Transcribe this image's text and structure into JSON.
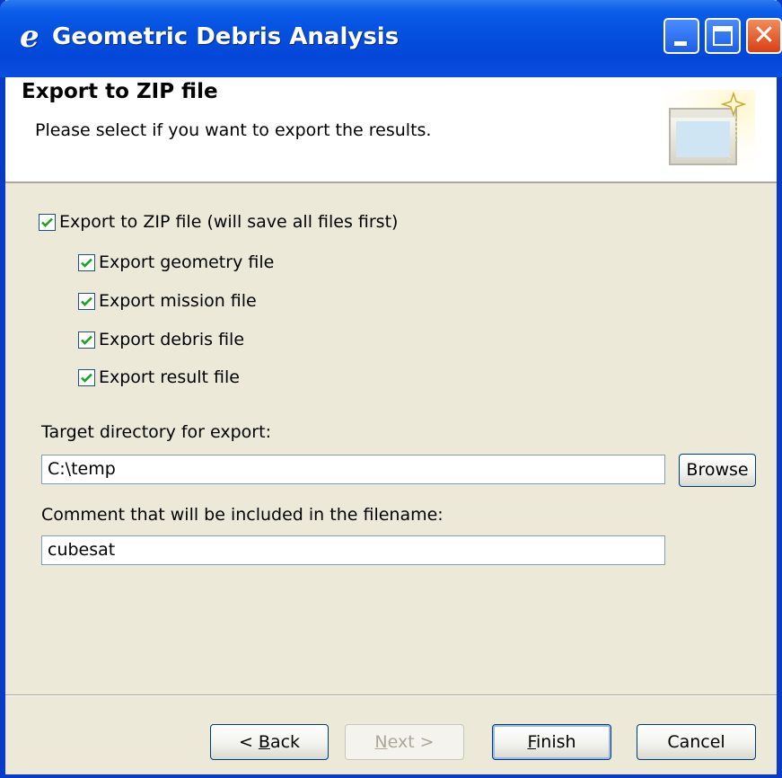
{
  "window": {
    "title": "Geometric Debris Analysis",
    "app_icon": "eclipse-e-icon",
    "buttons": {
      "minimize": "minimize-icon",
      "maximize": "maximize-icon",
      "close": "close-icon"
    }
  },
  "header": {
    "title": "Export to ZIP file",
    "description": "Please select if you want to export the results.",
    "graphic": "wizard-banner-icon"
  },
  "options": {
    "main": {
      "label": "Export to ZIP file (will save all files first)",
      "checked": true
    },
    "items": [
      {
        "label": "Export geometry file",
        "checked": true
      },
      {
        "label": "Export mission file",
        "checked": true
      },
      {
        "label": "Export debris file",
        "checked": true
      },
      {
        "label": "Export result file",
        "checked": true
      }
    ]
  },
  "target": {
    "label": "Target directory for export:",
    "value": "C:\\temp",
    "browse_label": "Browse"
  },
  "comment": {
    "label": "Comment that will be included in the filename:",
    "value": "cubesat"
  },
  "footer": {
    "back": {
      "mnemonic": "B",
      "prefix": "< ",
      "rest": "ack"
    },
    "next": {
      "mnemonic": "N",
      "rest": "ext >",
      "enabled": false
    },
    "finish": {
      "mnemonic": "F",
      "rest": "inish"
    },
    "cancel": "Cancel"
  },
  "colors": {
    "titlebar": "#0550e0",
    "window_border": "#0a3bc7",
    "dialog_bg": "#ece9d8",
    "checkmark": "#21a121",
    "close_button": "#d84016"
  }
}
